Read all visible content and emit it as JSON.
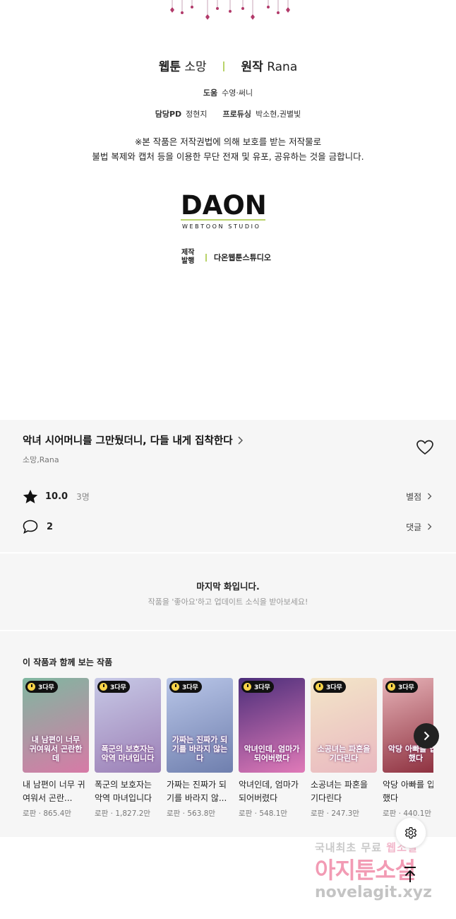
{
  "credits": {
    "webtoon_label": "웹툰",
    "webtoon_name": "소망",
    "original_label": "원작",
    "original_name": "Rana",
    "assist_label": "도움",
    "assist_name": "수영·써니",
    "pd_label": "담당PD",
    "pd_name": "정현지",
    "producing_label": "프로듀싱",
    "producing_name": "박소현,권별빛",
    "notice_line1": "※본 작품은 저작권법에 의해 보호를 받는 저작물로",
    "notice_line2": "불법 복제와 캡처 등을 이용한 무단 전재 및 유포, 공유하는 것을 금합니다.",
    "studio_logo": "DAON",
    "studio_logo_sub": "WEBTOON STUDIO",
    "publish_label_1": "제작",
    "publish_label_2": "발행",
    "publisher": "다온웹툰스튜디오",
    "accent_color": "#b9d36a"
  },
  "series": {
    "title": "악녀 시어머니를 그만뒀더니, 다들 내게 집착한다",
    "authors": "소망,Rana",
    "rating": "10.0",
    "rating_count": "3명",
    "rate_link": "별점",
    "comment_count": "2",
    "comment_link": "댓글",
    "icons": [
      "chevron-right-icon",
      "heart-icon",
      "star-icon",
      "comment-icon"
    ]
  },
  "last_episode": {
    "title": "마지막 화입니다.",
    "subtitle": "작품을 '좋아요'하고 업데이트 소식을 받아보세요!"
  },
  "recommendations": {
    "heading": "이 작품과 함께 보는 작품",
    "items": [
      {
        "badge": "3다무",
        "title": "내 남편이 너무 귀여워서 곤란...",
        "meta": "로판 · 865.4만",
        "thumb_text": "내 남편이 너무 귀여워서 곤란한데",
        "colors": [
          "#7fb7a0",
          "#d77aa6"
        ]
      },
      {
        "badge": "3다무",
        "title": "폭군의 보호자는 악역 마녀입니다",
        "meta": "로판 · 1,827.2만",
        "thumb_text": "폭군의 보호자는 악역 마녀입니다",
        "colors": [
          "#c7c9e6",
          "#9c7fb6"
        ]
      },
      {
        "badge": "3다무",
        "title": "가짜는 진짜가 되기를 바라지 않...",
        "meta": "로판 · 563.8만",
        "thumb_text": "가짜는 진짜가 되기를 바라지 않는다",
        "colors": [
          "#b9c6e8",
          "#6f7fae"
        ]
      },
      {
        "badge": "3다무",
        "title": "악녀인데, 엄마가 되어버렸다",
        "meta": "로판 · 548.1만",
        "thumb_text": "악녀인데, 엄마가 되어버렸다",
        "colors": [
          "#4b2e7a",
          "#e07ab8"
        ]
      },
      {
        "badge": "3다무",
        "title": "소공녀는 파혼을 기다린다",
        "meta": "로판 · 247.3만",
        "thumb_text": "소공녀는 파혼을 기다린다",
        "colors": [
          "#f3e6c8",
          "#e9b8c0"
        ]
      },
      {
        "badge": "3다무",
        "title": "악당 아빠를 입양했다",
        "meta": "로판 · 440.1만",
        "thumb_text": "악당 아빠를 입양했다",
        "colors": [
          "#e7b3b8",
          "#8a2b3a"
        ]
      }
    ]
  },
  "controls": {
    "next_icon": "chevron-right-icon",
    "settings_icon": "gear-icon",
    "top_icon": "arrow-up-icon"
  },
  "watermark": {
    "line1_a": "국내최초 무료",
    "line1_b": "웹소설",
    "line2": "아지툰소설",
    "line3": "novelagit.xyz"
  }
}
